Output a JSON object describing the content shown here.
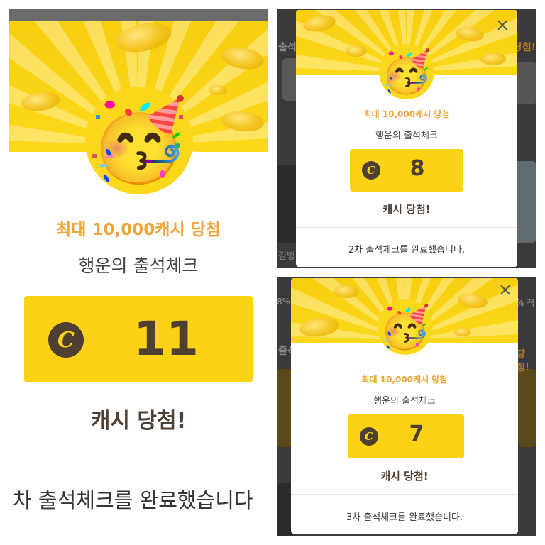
{
  "panels": [
    {
      "subtitle": "최대 10,000캐시 당첨",
      "heading": "행운의 출석체크",
      "coin_symbol": "C",
      "cash_value": "11",
      "win_label": "캐시 당첨!",
      "complete_text": "차 출석체크를 완료했습니다"
    },
    {
      "subtitle": "최대 10,000캐시 당첨",
      "heading": "행운의 출석체크",
      "coin_symbol": "C",
      "cash_value": "8",
      "win_label": "캐시 당첨!",
      "complete_text": "2차 출석체크를 완료했습니다.",
      "close_label": "×"
    },
    {
      "subtitle": "최대 10,000캐시 당첨",
      "heading": "행운의 출석체크",
      "coin_symbol": "C",
      "cash_value": "7",
      "win_label": "캐시 당첨!",
      "complete_text": "3차 출석체크를 완료했습니다.",
      "close_label": "×"
    }
  ],
  "background_fragments": {
    "left_labels": [
      "출석",
      "출석"
    ],
    "right_labels": [
      "당첨!",
      "당첨!"
    ],
    "misc": [
      "김병",
      "8%",
      "% 적"
    ]
  },
  "icons": {
    "emoji": "🥳",
    "coin": "coin-c-icon",
    "close": "close-icon"
  },
  "colors": {
    "accent_yellow": "#fbd314",
    "subtitle_orange": "#f0a43a",
    "brown": "#4f3f33"
  }
}
